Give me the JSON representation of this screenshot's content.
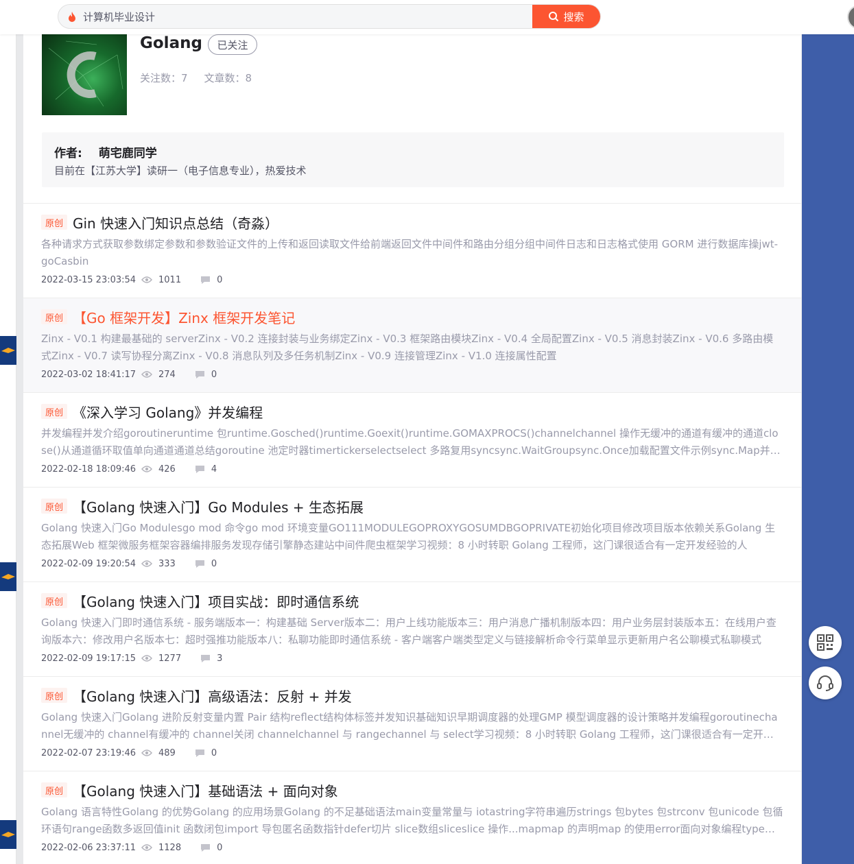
{
  "search": {
    "query": "计算机毕业设计",
    "button_label": "搜索"
  },
  "column": {
    "title": "Golang",
    "follow_label": "已关注",
    "followers_label": "关注数：7",
    "articles_label": "文章数：8"
  },
  "author": {
    "label": "作者:",
    "name": "萌宅鹿同学",
    "desc": "目前在【江苏大学】读研一（电子信息专业），热爱技术"
  },
  "articles": [
    {
      "tag": "原创",
      "title": "Gin 快速入门知识点总结（奇淼）",
      "desc": "各种请求方式获取参数绑定参数和参数验证文件的上传和返回读取文件给前端返回文件中间件和路由分组分组中间件日志和日志格式使用 GORM 进行数据库操jwt-goCasbin",
      "date": "2022-03-15 23:03:54",
      "views": "1011",
      "comments": "0"
    },
    {
      "tag": "原创",
      "title": "【Go 框架开发】Zinx 框架开发笔记",
      "desc": "Zinx - V0.1 构建最基础的 serverZinx - V0.2 连接封装与业务绑定Zinx - V0.3 框架路由模块Zinx - V0.4 全局配置Zinx - V0.5 消息封装Zinx - V0.6 多路由模式Zinx - V0.7 读写协程分离Zinx - V0.8 消息队列及多任务机制Zinx - V0.9 连接管理Zinx - V1.0 连接属性配置",
      "date": "2022-03-02 18:41:17",
      "views": "274",
      "comments": "0"
    },
    {
      "tag": "原创",
      "title": "《深入学习 Golang》并发编程",
      "desc": "并发编程并发介绍goroutineruntime 包runtime.Gosched()runtime.Goexit()runtime.GOMAXPROCS()channelchannel 操作无缓冲的通道有缓冲的通道close()从通道循环取值单向通道通道总结goroutine 池定时器timertickerselectselect 多路复用syncsync.WaitGroupsync.Once加载配置文件示例sync.Map并发安全和锁",
      "date": "2022-02-18 18:09:46",
      "views": "426",
      "comments": "4"
    },
    {
      "tag": "原创",
      "title": "【Golang 快速入门】Go Modules + 生态拓展",
      "desc": "Golang 快速入门Go Modulesgo mod 命令go mod 环境变量GO111MODULEGOPROXYGOSUMDBGOPRIVATE初始化项目修改项目版本依赖关系Golang 生态拓展Web 框架微服务框架容器编排服务发现存储引擎静态建站中间件爬虫框架学习视频：8 小时转职 Golang 工程师，这门课很适合有一定开发经验的人",
      "date": "2022-02-09 19:20:54",
      "views": "333",
      "comments": "0"
    },
    {
      "tag": "原创",
      "title": "【Golang 快速入门】项目实战：即时通信系统",
      "desc": "Golang 快速入门即时通信系统 - 服务端版本一：构建基础 Server版本二：用户上线功能版本三：用户消息广播机制版本四：用户业务层封装版本五：在线用户查询版本六：修改用户名版本七：超时强推功能版本八：私聊功能即时通信系统 - 客户端客户端类型定义与链接解析命令行菜单显示更新用户名公聊模式私聊模式",
      "date": "2022-02-09 19:17:15",
      "views": "1277",
      "comments": "3"
    },
    {
      "tag": "原创",
      "title": "【Golang 快速入门】高级语法：反射 + 并发",
      "desc": "Golang 快速入门Golang 进阶反射变量内置 Pair 结构reflect结构体标签并发知识基础知识早期调度器的处理GMP 模型调度器的设计策略并发编程goroutinechannel无缓冲的 channel有缓冲的 channel关闭 channelchannel 与 rangechannel 与 select学习视频：8 小时转职 Golang 工程师，这门课很适合有一定开发经验的人",
      "date": "2022-02-07 23:19:46",
      "views": "489",
      "comments": "0"
    },
    {
      "tag": "原创",
      "title": "【Golang 快速入门】基础语法 + 面向对象",
      "desc": "Golang 语言特性Golang 的优势Golang 的应用场景Golang 的不足基础语法main变量常量与 iotastring字符串遍历strings 包bytes 包strconv 包unicode 包循环语句range函数多返回值init 函数闭包import 导包匿名函数指针defer切片 slice数组sliceslice 操作...mapmap 的声明map 的使用error面向对象编程type方法结构体",
      "date": "2022-02-06 23:37:11",
      "views": "1128",
      "comments": "0"
    }
  ],
  "icons": {
    "fire": "fire-icon",
    "search": "search-icon",
    "eye": "eye-icon",
    "comment": "comment-icon",
    "qrcode": "qrcode-icon",
    "headset": "headset-icon"
  },
  "colors": {
    "accent": "#fc5531",
    "side_band": "#3e5ea9"
  }
}
